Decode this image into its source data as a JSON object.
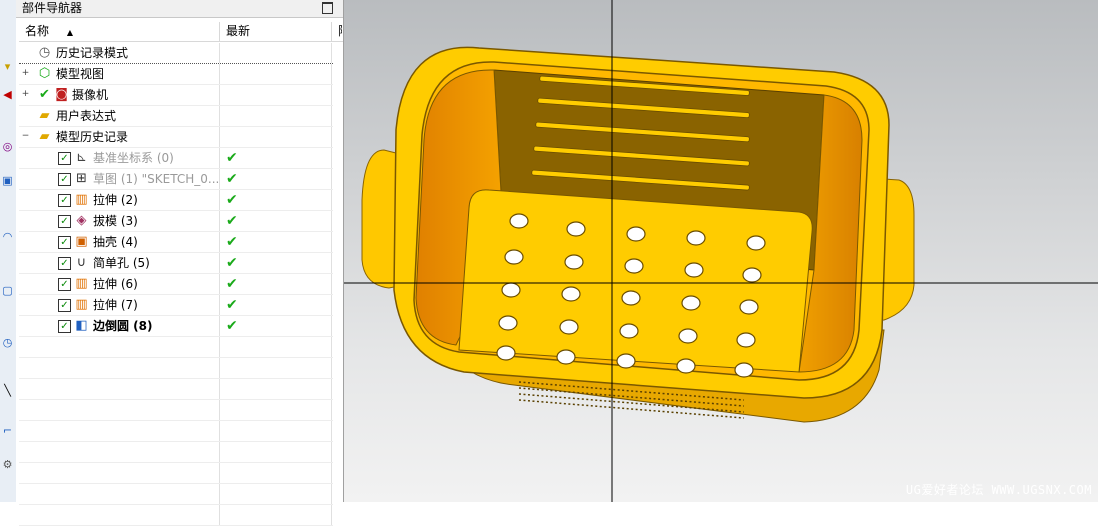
{
  "panel": {
    "title": "部件导航器"
  },
  "columns": {
    "name": "名称",
    "latest": "最新",
    "extra": "附"
  },
  "tree": {
    "history_mode": "历史记录模式",
    "model_views": "模型视图",
    "cameras": "摄像机",
    "user_expressions": "用户表达式",
    "model_history": "模型历史记录"
  },
  "features": [
    {
      "label": "基准坐标系 (0)",
      "latest": "✔"
    },
    {
      "label": "草图 (1) \"SKETCH_0...",
      "latest": "✔"
    },
    {
      "label": "拉伸 (2)",
      "latest": "✔"
    },
    {
      "label": "拔模 (3)",
      "latest": "✔"
    },
    {
      "label": "抽壳 (4)",
      "latest": "✔"
    },
    {
      "label": "简单孔 (5)",
      "latest": "✔"
    },
    {
      "label": "拉伸 (6)",
      "latest": "✔"
    },
    {
      "label": "拉伸 (7)",
      "latest": "✔"
    },
    {
      "label": "边倒圆 (8)",
      "latest": "✔"
    }
  ],
  "watermark": "UG爱好者论坛 WWW.UGSNX.COM",
  "colors": {
    "model_yellow": "#ffcc00",
    "model_orange": "#e08c00",
    "model_dark": "#7a5800",
    "viewport_top": "#b9bcbf",
    "check_green": "#1aaa1a"
  },
  "icons": {
    "history_mode": "clock-icon",
    "model_views": "views-icon",
    "cameras": "camera-icon",
    "folder": "folder-icon",
    "datum": "datum-csys-icon",
    "sketch": "sketch-icon",
    "extrude": "extrude-icon",
    "draft": "draft-icon",
    "shell": "shell-icon",
    "hole": "hole-icon",
    "blend": "edge-blend-icon"
  }
}
